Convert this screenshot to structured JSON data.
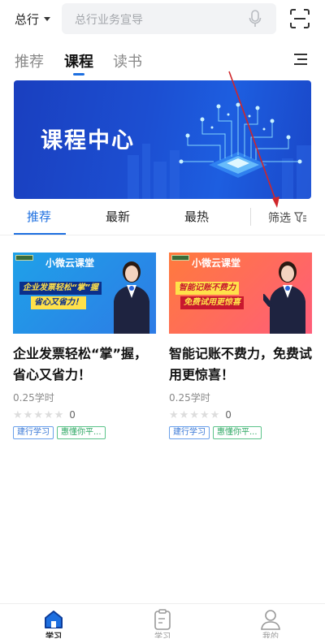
{
  "header": {
    "location_label": "总行",
    "search_placeholder": "总行业务宣导"
  },
  "main_tabs": [
    {
      "label": "推荐",
      "active": false
    },
    {
      "label": "课程",
      "active": true
    },
    {
      "label": "读书",
      "active": false
    }
  ],
  "banner": {
    "title": "课程中心"
  },
  "sub_tabs": [
    {
      "label": "推荐",
      "active": true
    },
    {
      "label": "最新",
      "active": false
    },
    {
      "label": "最热",
      "active": false
    }
  ],
  "filter_label": "筛选",
  "courses": [
    {
      "thumb_brand": "小微云课堂",
      "thumb_slogan_1": "企业发票轻松“掌”握",
      "thumb_slogan_2": "省心又省力！",
      "title": "企业发票轻松“掌”握，省心又省力！",
      "hours": "0.25学时",
      "rating": 0,
      "rating_count": "0",
      "tags": [
        "建行学习",
        "惠懂你平..."
      ]
    },
    {
      "thumb_brand": "小微云课堂",
      "thumb_slogan_1": "智能记账不费力",
      "thumb_slogan_2": "免费试用更惊喜",
      "title": "智能记账不费力，免费试用更惊喜！",
      "hours": "0.25学时",
      "rating": 0,
      "rating_count": "0",
      "tags": [
        "建行学习",
        "惠懂你平..."
      ]
    }
  ],
  "bottom_nav": [
    {
      "label": "学习",
      "icon": "home-icon",
      "active": true
    },
    {
      "label": "学习",
      "icon": "clipboard-icon",
      "active": false
    },
    {
      "label": "我的",
      "icon": "user-icon",
      "active": false
    }
  ],
  "colors": {
    "accent": "#1d6fe0",
    "annotation": "#d0262a"
  }
}
